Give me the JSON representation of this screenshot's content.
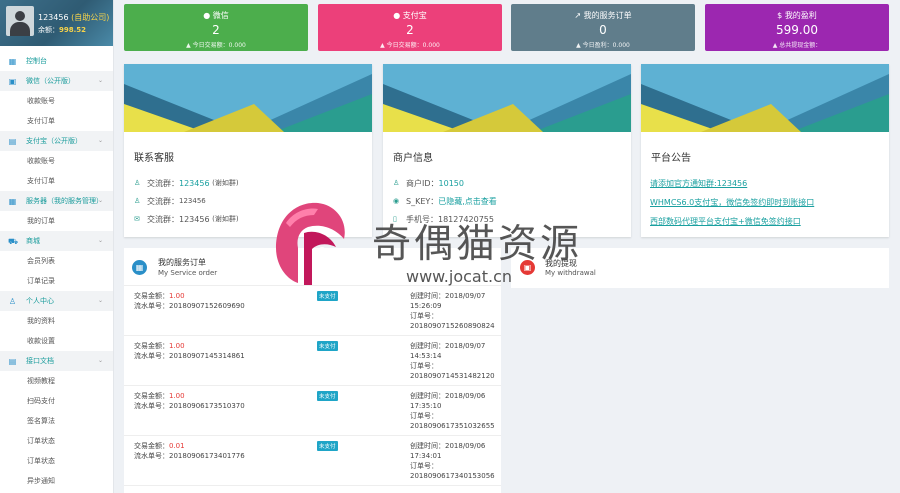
{
  "profile": {
    "username": "123456",
    "tag": "(自助公司)",
    "balance_label": "余额：",
    "balance": "998.52"
  },
  "menu": [
    {
      "type": "first",
      "icon": "▦",
      "label": "控制台"
    },
    {
      "type": "cat",
      "icon": "▣",
      "label": "微信（公开版）",
      "chev": "⌄"
    },
    {
      "type": "sub",
      "label": "收款账号"
    },
    {
      "type": "sub",
      "label": "支付订单"
    },
    {
      "type": "cat",
      "icon": "▤",
      "label": "支付宝（公开版）",
      "chev": "⌄"
    },
    {
      "type": "sub",
      "label": "收款账号"
    },
    {
      "type": "sub",
      "label": "支付订单"
    },
    {
      "type": "cat",
      "icon": "▦",
      "label": "服务器（我的服务管理）",
      "chev": "⌄"
    },
    {
      "type": "sub",
      "label": "我的订单"
    },
    {
      "type": "cat",
      "icon": "⛟",
      "label": "商城",
      "chev": "⌄"
    },
    {
      "type": "sub",
      "label": "会员列表"
    },
    {
      "type": "sub",
      "label": "订单记录"
    },
    {
      "type": "cat",
      "icon": "♙",
      "label": "个人中心",
      "chev": "⌄"
    },
    {
      "type": "sub",
      "label": "我的资料"
    },
    {
      "type": "sub",
      "label": "收款设置"
    },
    {
      "type": "cat",
      "icon": "▤",
      "label": "接口文档",
      "chev": "⌄"
    },
    {
      "type": "sub",
      "label": "视频教程"
    },
    {
      "type": "sub",
      "label": "扫码支付"
    },
    {
      "type": "sub",
      "label": "签名算法"
    },
    {
      "type": "sub",
      "label": "订单状态"
    },
    {
      "type": "sub",
      "label": "订单状态"
    },
    {
      "type": "sub",
      "label": "异步通知"
    }
  ],
  "stats": [
    {
      "title": "微信",
      "icon": "●",
      "value": "2",
      "sub": "▲ 今日交易额：0.000"
    },
    {
      "title": "支付宝",
      "icon": "●",
      "value": "2",
      "sub": "▲ 今日交易额：0.000"
    },
    {
      "title": "我的服务订单",
      "icon": "↗",
      "value": "0",
      "sub": "▲ 今日盈利：0.000"
    },
    {
      "title": "我的盈利",
      "icon": "$",
      "value": "599.00",
      "sub": "▲ 总共提现金额："
    }
  ],
  "contact": {
    "title": "联系客服",
    "rows": [
      {
        "icon": "♙",
        "label": "交流群：",
        "value": "123456",
        "note": "(谢如群)"
      },
      {
        "icon": "♙",
        "label": "交流群：",
        "value": "123456",
        "note": ""
      },
      {
        "icon": "✉",
        "label": "交流群：",
        "value": "123456",
        "note": "(谢如群)"
      }
    ]
  },
  "merchant": {
    "title": "商户信息",
    "rows": [
      {
        "icon": "♙",
        "label": "商户ID：",
        "value": "10150"
      },
      {
        "icon": "◉",
        "label": "S_KEY：",
        "value": "已隐藏,点击查看"
      },
      {
        "icon": "▯",
        "label": "手机号：",
        "value": "18127420755"
      }
    ]
  },
  "notice": {
    "title": "平台公告",
    "items": [
      "请添加官方通知群:123456",
      "WHMCS6.0支付宝，微信免签约即时到账接口",
      "西部数码代理平台支付宝+微信免签约接口"
    ]
  },
  "orders": {
    "icon": "▦",
    "title": "我的服务订单",
    "subtitle": "My Service order",
    "items": [
      {
        "amount_label": "交易金额：",
        "amount": "1.00",
        "serial_label": "流水单号：",
        "serial": "20180907152609690",
        "badge": "未支付",
        "created_label": "创建时间：",
        "created_date": "2018/09/07",
        "created_time": "15:26:09",
        "order_label": "订单号：",
        "order_no": "2018090715260890824"
      },
      {
        "amount_label": "交易金额：",
        "amount": "1.00",
        "serial_label": "流水单号：",
        "serial": "20180907145314861",
        "badge": "未支付",
        "created_label": "创建时间：",
        "created_date": "2018/09/07",
        "created_time": "14:53:14",
        "order_label": "订单号：",
        "order_no": "2018090714531482120"
      },
      {
        "amount_label": "交易金额：",
        "amount": "1.00",
        "serial_label": "流水单号：",
        "serial": "20180906173510370",
        "badge": "未支付",
        "created_label": "创建时间：",
        "created_date": "2018/09/06",
        "created_time": "17:35:10",
        "order_label": "订单号：",
        "order_no": "2018090617351032655"
      },
      {
        "amount_label": "交易金额：",
        "amount": "0.01",
        "serial_label": "流水单号：",
        "serial": "20180906173401776",
        "badge": "未支付",
        "created_label": "创建时间：",
        "created_date": "2018/09/06",
        "created_time": "17:34:01",
        "order_label": "订单号：",
        "order_no": "2018090617340153056"
      }
    ]
  },
  "withdraw": {
    "icon": "▣",
    "title": "我的提现",
    "subtitle": "My withdrawal"
  },
  "watermark": {
    "name": "奇偶猫资源",
    "url": "www.jocat.cn"
  },
  "colors": {
    "wechat": "#4cae4c",
    "alipay": "#ec407a",
    "service": "#607d8b",
    "profit": "#9c27b0",
    "link": "#1aa0a0",
    "amount": "#e53935"
  }
}
